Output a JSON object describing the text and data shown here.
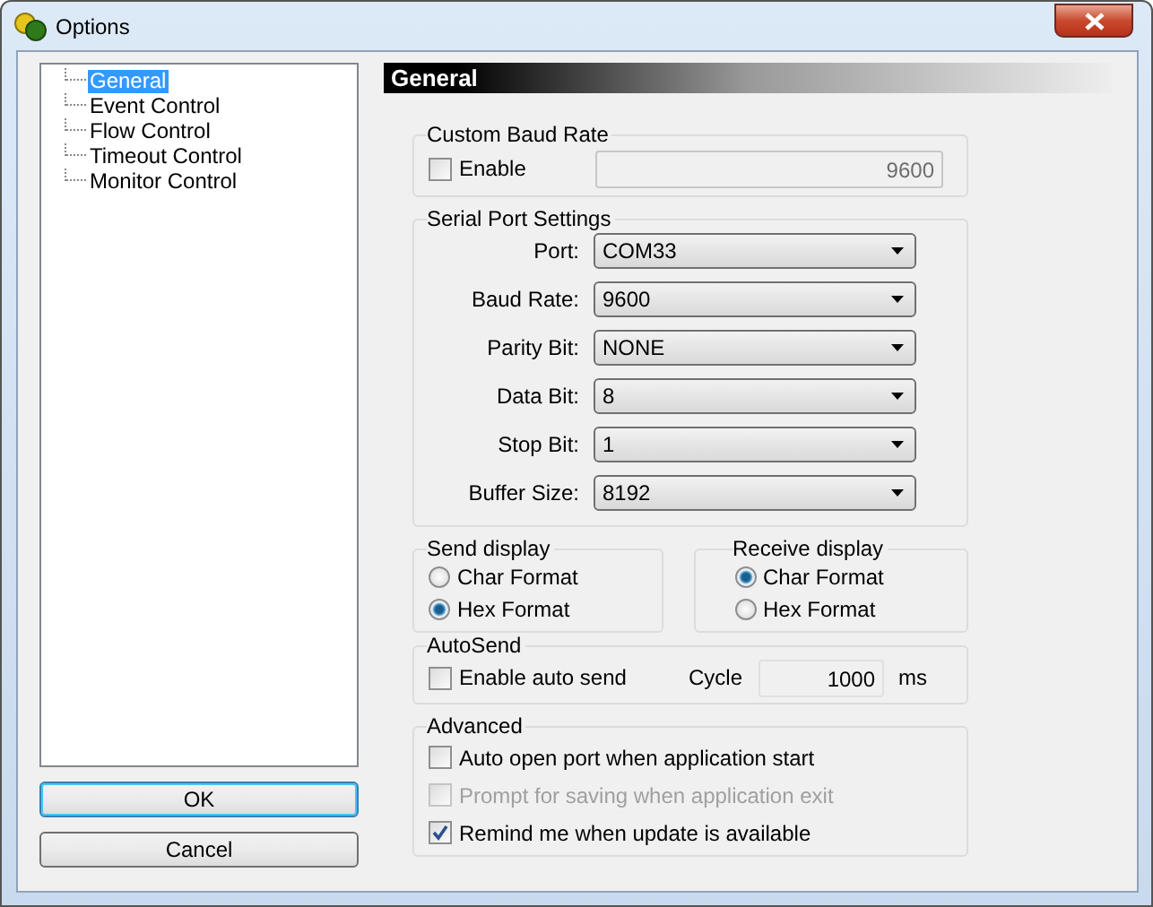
{
  "window": {
    "title": "Options"
  },
  "tree": {
    "items": [
      {
        "label": "General",
        "selected": true
      },
      {
        "label": "Event Control",
        "selected": false
      },
      {
        "label": "Flow Control",
        "selected": false
      },
      {
        "label": "Timeout Control",
        "selected": false
      },
      {
        "label": "Monitor Control",
        "selected": false
      }
    ]
  },
  "buttons": [
    {
      "label": "OK",
      "default": true
    },
    {
      "label": "Cancel",
      "default": false
    }
  ],
  "section_title": "General",
  "custom_baud": {
    "title": "Custom Baud Rate",
    "checkbox": {
      "label": "Enable",
      "checked": false
    },
    "value": "9600"
  },
  "serial": {
    "title": "Serial Port Settings",
    "fields": [
      {
        "label": "Port:",
        "value": "COM33"
      },
      {
        "label": "Baud Rate:",
        "value": "9600"
      },
      {
        "label": "Parity Bit:",
        "value": "NONE"
      },
      {
        "label": "Data Bit:",
        "value": "8"
      },
      {
        "label": "Stop Bit:",
        "value": "1"
      },
      {
        "label": "Buffer Size:",
        "value": "8192"
      }
    ]
  },
  "send_display": {
    "title": "Send display",
    "options": [
      {
        "label": "Char Format",
        "selected": false
      },
      {
        "label": "Hex  Format",
        "selected": true
      }
    ]
  },
  "receive_display": {
    "title": "Receive display",
    "options": [
      {
        "label": "Char Format",
        "selected": true
      },
      {
        "label": "Hex  Format",
        "selected": false
      }
    ]
  },
  "autosend": {
    "title": "AutoSend",
    "checkbox": {
      "label": "Enable auto send",
      "checked": false
    },
    "cycle_label": "Cycle",
    "cycle_value": "1000",
    "unit": "ms"
  },
  "advanced": {
    "title": "Advanced",
    "options": [
      {
        "label": "Auto open port when application start",
        "checked": false,
        "disabled": false
      },
      {
        "label": "Prompt for saving when application exit",
        "checked": false,
        "disabled": true
      },
      {
        "label": "Remind me when update is available",
        "checked": true,
        "disabled": false
      }
    ]
  }
}
